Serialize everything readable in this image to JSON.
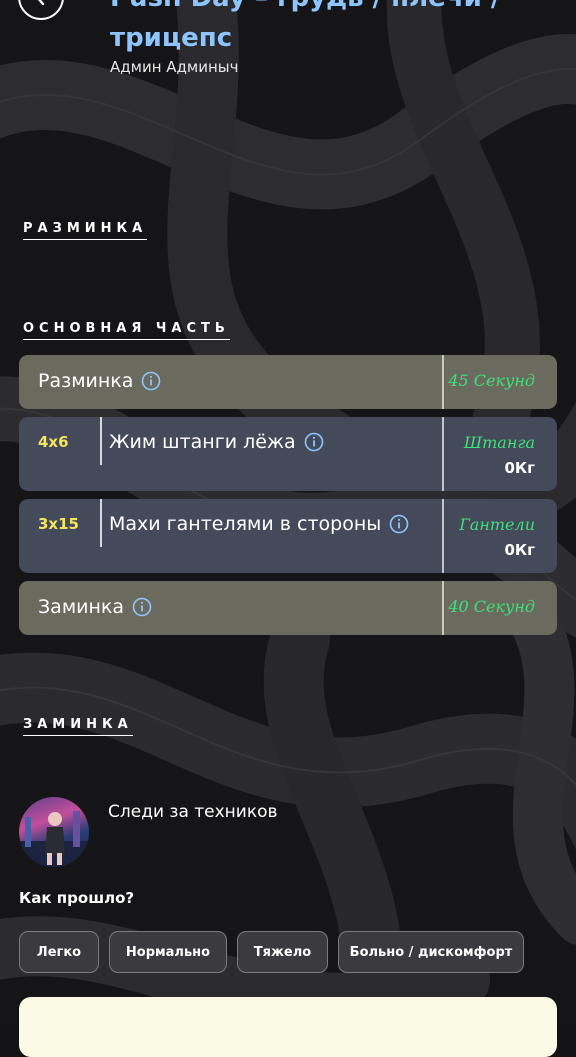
{
  "header": {
    "title_line1": "Push Day – грудь / плечи /",
    "title_line2": "трицепс",
    "author": "Админ Админыч"
  },
  "sections": {
    "warmup": "РАЗМИНКА",
    "main": "ОСНОВНАЯ ЧАСТЬ",
    "cooldown": "ЗАМИНКА"
  },
  "items": [
    {
      "name": "Разминка",
      "right": "45 Секунд"
    },
    {
      "sets": "4x6",
      "name": "Жим штанги лёжа",
      "equipment": "Штанга",
      "weight": "0Кг"
    },
    {
      "sets": "3x15",
      "name": "Махи гантелями в стороны",
      "equipment": "Гантели",
      "weight": "0Кг"
    },
    {
      "name": "Заминка",
      "right": "40 Секунд"
    }
  ],
  "follow": {
    "text": "Следи за техников"
  },
  "feedback": {
    "question": "Как прошло?",
    "options": [
      "Легко",
      "Нормально",
      "Тяжело",
      "Больно / дискомфорт"
    ]
  },
  "colors": {
    "title": "#8ec5ff",
    "time_text": "#3ee07a",
    "sets_text": "#f3e65a",
    "card_olive": "#6b6a5e",
    "card_slate": "#454a5a"
  },
  "icons": [
    "back-arrow-icon",
    "info-icon"
  ]
}
